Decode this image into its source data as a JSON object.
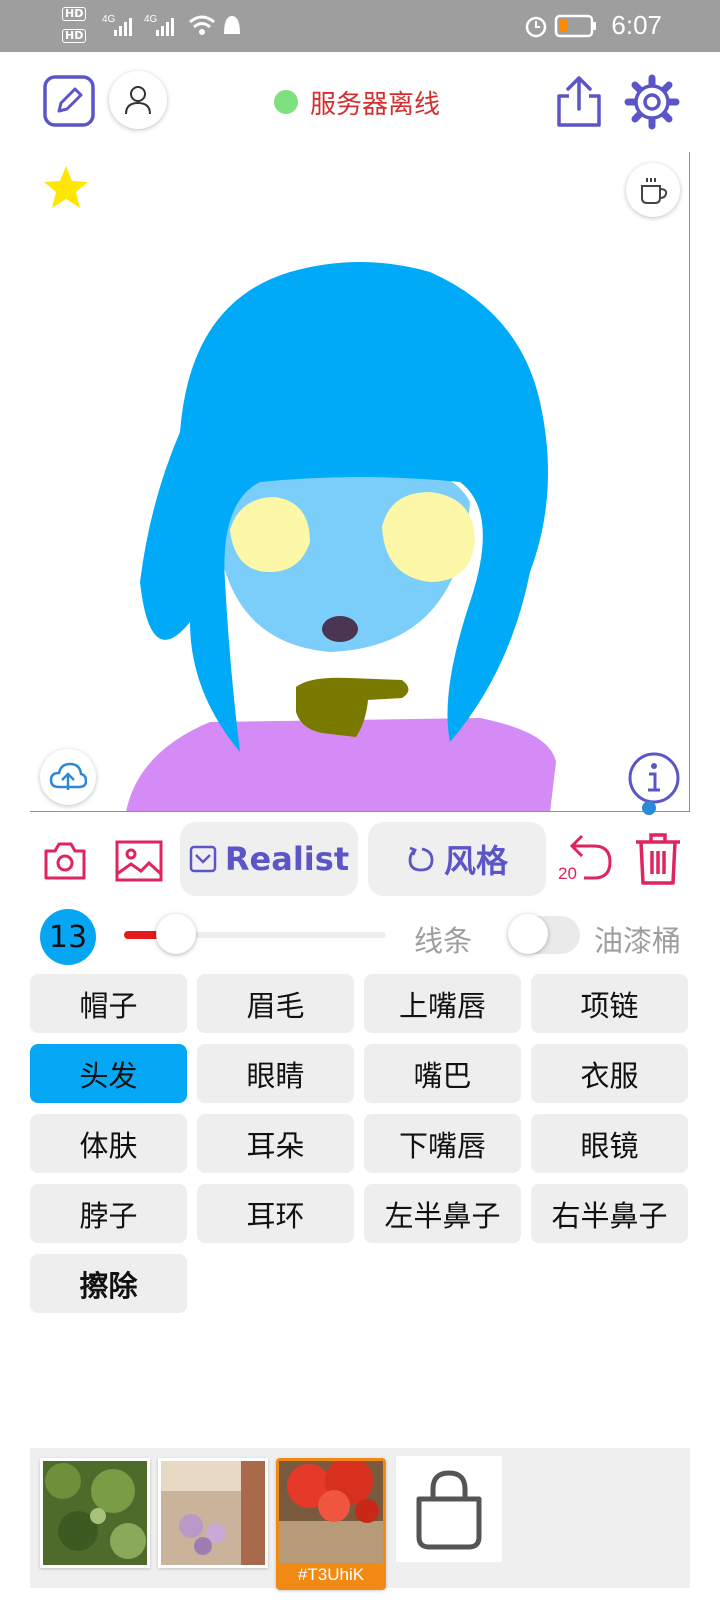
{
  "status_bar": {
    "time": "6:07",
    "hd1": "HD",
    "hd2": "HD",
    "signal1": "4G",
    "signal2": "4G"
  },
  "header": {
    "server_status": "服务器离线",
    "status_color": "#7ee07e"
  },
  "toolbar": {
    "model_label": "Realist",
    "style_label": "风格",
    "undo_count": "20"
  },
  "brush": {
    "size": "13",
    "line_label": "线条",
    "bucket_label": "油漆桶",
    "size_fraction": 0.2
  },
  "parts": [
    {
      "label": "帽子"
    },
    {
      "label": "眉毛"
    },
    {
      "label": "上嘴唇"
    },
    {
      "label": "项链"
    },
    {
      "label": "头发",
      "selected": true
    },
    {
      "label": "眼睛"
    },
    {
      "label": "嘴巴"
    },
    {
      "label": "衣服"
    },
    {
      "label": "体肤"
    },
    {
      "label": "耳朵"
    },
    {
      "label": "下嘴唇"
    },
    {
      "label": "眼镜"
    },
    {
      "label": "脖子"
    },
    {
      "label": "耳环"
    },
    {
      "label": "左半鼻子"
    },
    {
      "label": "右半鼻子"
    },
    {
      "label": "擦除"
    }
  ],
  "gallery": {
    "selected_tag": "#T3UhiK"
  },
  "colors": {
    "accent": "#5b55c8",
    "selection": "#06a8f5",
    "danger": "#e0245e",
    "hair": "#00aaf7",
    "skin": "#7ccefa"
  },
  "icons": [
    "pen-square-icon",
    "user-icon",
    "share-icon",
    "gear-icon",
    "star-icon",
    "coffee-icon",
    "cloud-upload-icon",
    "info-icon",
    "camera-icon",
    "image-icon",
    "checkbox-icon",
    "undo-icon",
    "trash-icon",
    "bag-icon"
  ]
}
